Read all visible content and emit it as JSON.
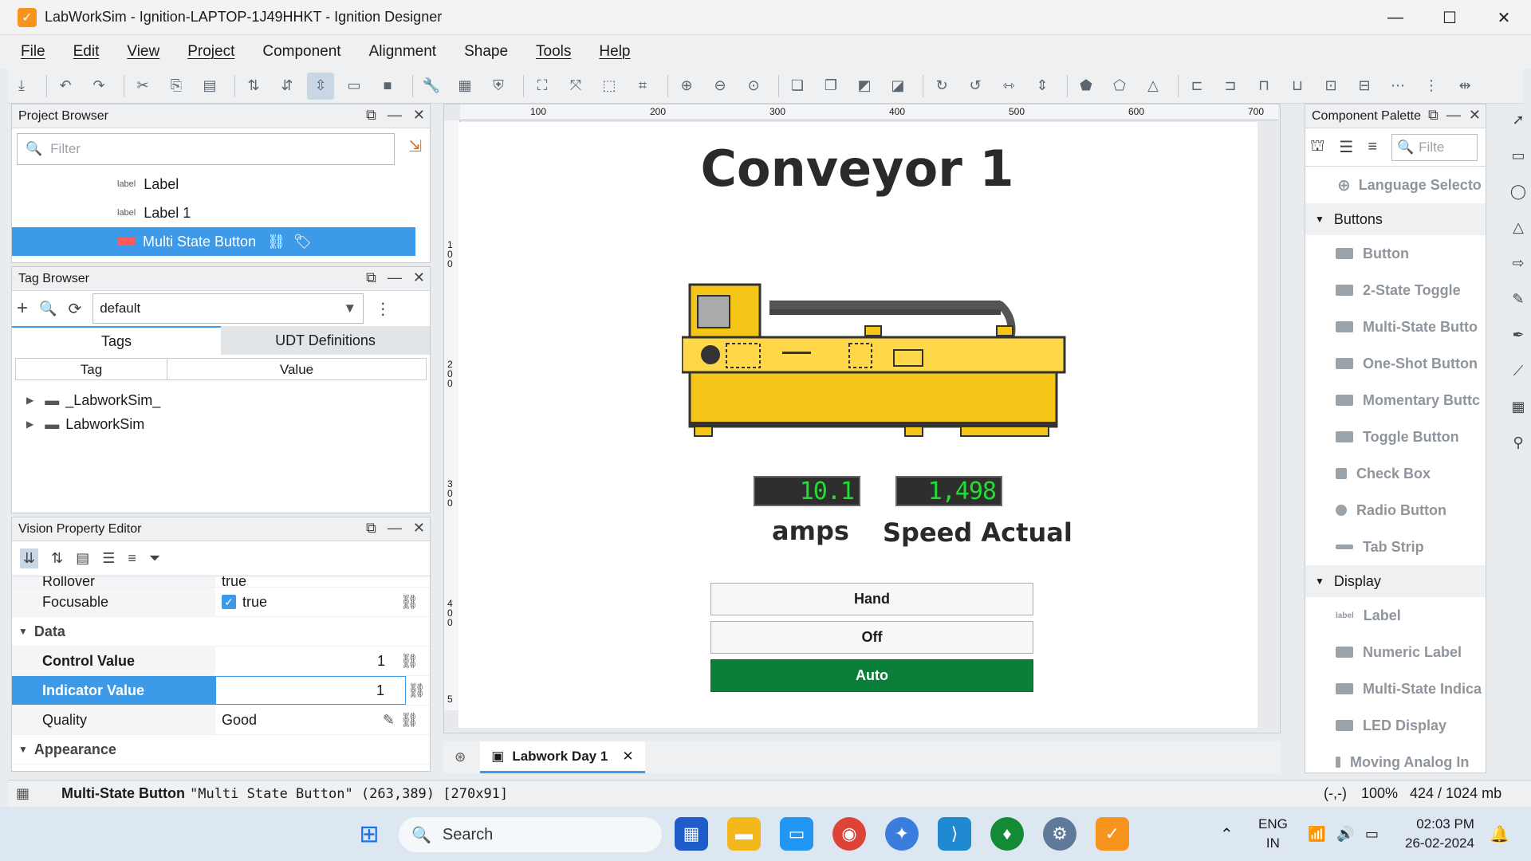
{
  "window": {
    "title": "LabWorkSim - Ignition-LAPTOP-1J49HHKT - Ignition Designer",
    "minimize": "—",
    "maximize": "☐",
    "close": "✕"
  },
  "menu": [
    "File",
    "Edit",
    "View",
    "Project",
    "Component",
    "Alignment",
    "Shape",
    "Tools",
    "Help"
  ],
  "project_browser": {
    "title": "Project Browser",
    "filter_placeholder": "Filter",
    "items": [
      {
        "label": "Label"
      },
      {
        "label": "Label 1"
      },
      {
        "label": "Multi State Button"
      }
    ]
  },
  "tag_browser": {
    "title": "Tag Browser",
    "provider": "default",
    "tabs": [
      "Tags",
      "UDT Definitions"
    ],
    "columns": [
      "Tag",
      "Value"
    ],
    "folders": [
      "_LabworkSim_",
      "LabworkSim"
    ]
  },
  "property_editor": {
    "title": "Vision Property Editor",
    "rows": [
      {
        "name": "Rollover",
        "value": "true",
        "type": "check"
      },
      {
        "name": "Focusable",
        "value": "true",
        "type": "check"
      },
      {
        "section": "Data"
      },
      {
        "name": "Control Value",
        "value": "1",
        "type": "num",
        "bold": true
      },
      {
        "name": "Indicator Value",
        "value": "1",
        "type": "num",
        "bold": true,
        "selected": true
      },
      {
        "name": "Quality",
        "value": "Good",
        "type": "text"
      },
      {
        "section": "Appearance"
      }
    ]
  },
  "canvas": {
    "title": "Conveyor 1",
    "amps_value": "10.1",
    "amps_label": "amps",
    "speed_value": "1,498",
    "speed_label": "Speed Actual",
    "buttons": [
      {
        "label": "Hand",
        "active": false
      },
      {
        "label": "Off",
        "active": false
      },
      {
        "label": "Auto",
        "active": true
      }
    ],
    "ruler_top": [
      "100",
      "200",
      "300",
      "400",
      "500",
      "600",
      "700"
    ],
    "ruler_left": [
      "1 0 0",
      "2 0 0",
      "3 0 0",
      "4 0 0",
      "5"
    ],
    "tab_label": "Labwork Day 1"
  },
  "palette": {
    "title": "Component Palette",
    "search_placeholder": "Filte",
    "top_item": "Language Selecto",
    "groups": [
      {
        "name": "Buttons",
        "items": [
          "Button",
          "2-State Toggle",
          "Multi-State Butto",
          "One-Shot Button",
          "Momentary Buttc",
          "Toggle Button",
          "Check Box",
          "Radio Button",
          "Tab Strip"
        ]
      },
      {
        "name": "Display",
        "items": [
          "Label",
          "Numeric Label",
          "Multi-State Indica",
          "LED Display",
          "Moving Analog In"
        ]
      }
    ]
  },
  "status": {
    "component_type": "Multi-State Button",
    "component_info": "\"Multi State Button\" (263,389) [270x91]",
    "coords": "(-,-)",
    "zoom": "100%",
    "memory": "424 / 1024 mb"
  },
  "taskbar": {
    "search": "Search",
    "lang_top": "ENG",
    "lang_bottom": "IN",
    "time": "02:03 PM",
    "date": "26-02-2024"
  },
  "colors": {
    "accent": "#3d9ae8",
    "auto_button": "#0b7f3a",
    "led_text": "#22dd33",
    "conveyor_yellow": "#f5c518"
  }
}
